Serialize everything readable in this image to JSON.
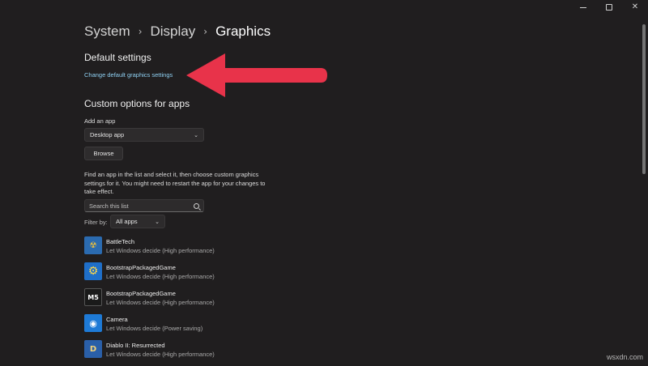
{
  "window": {
    "minimize_glyph": "",
    "maximize_glyph": "",
    "close_glyph": "✕"
  },
  "breadcrumb": {
    "items": [
      "System",
      "Display",
      "Graphics"
    ],
    "separator": "›"
  },
  "default_settings": {
    "title": "Default settings",
    "link": "Change default graphics settings"
  },
  "custom_options": {
    "title": "Custom options for apps",
    "add_app_label": "Add an app",
    "app_type_selected": "Desktop app",
    "browse_label": "Browse",
    "description": "Find an app in the list and select it, then choose custom graphics settings for it. You might need to restart the app for your changes to take effect.",
    "search_placeholder": "Search this list",
    "filter_label": "Filter by:",
    "filter_selected": "All apps"
  },
  "apps": [
    {
      "name": "BattleTech",
      "setting": "Let Windows decide (High performance)",
      "icon": "battletech-icon",
      "color": "#2b6bb0"
    },
    {
      "name": "BootstrapPackagedGame",
      "setting": "Let Windows decide (High performance)",
      "icon": "gear-icon",
      "color": "#1f6fc9"
    },
    {
      "name": "BootstrapPackagedGame",
      "setting": "Let Windows decide (High performance)",
      "icon": "m5-icon",
      "color": "#1a1a1a"
    },
    {
      "name": "Camera",
      "setting": "Let Windows decide (Power saving)",
      "icon": "camera-icon",
      "color": "#1e7ad6"
    },
    {
      "name": "Diablo II: Resurrected",
      "setting": "Let Windows decide (High performance)",
      "icon": "diablo-icon",
      "color": "#2a5fa8"
    }
  ],
  "icon_glyphs": {
    "gear": "⚙",
    "m5": "M5",
    "camera": "◉",
    "diablo": "D",
    "battletech": "☢"
  },
  "watermark": "wsxdn.com",
  "colors": {
    "link": "#8fd0f2",
    "arrow": "#e8334a",
    "background": "#201e1f"
  }
}
